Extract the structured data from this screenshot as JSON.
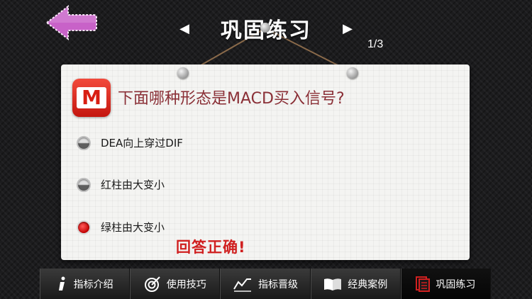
{
  "header": {
    "title": "巩固练习",
    "prev_arrow": "◀",
    "next_arrow": "▶",
    "counter": "1/3"
  },
  "question": {
    "logo_letter": "M",
    "text": "下面哪种形态是MACD买入信号?",
    "options": [
      {
        "label": "DEA向上穿过DIF",
        "selected": false
      },
      {
        "label": "红柱由大变小",
        "selected": false
      },
      {
        "label": "绿柱由大变小",
        "selected": true
      }
    ],
    "result": "回答正确!"
  },
  "tabs": [
    {
      "label": "指标介绍",
      "icon": "info-icon",
      "active": false
    },
    {
      "label": "使用技巧",
      "icon": "target-icon",
      "active": false
    },
    {
      "label": "指标晋级",
      "icon": "chart-up-icon",
      "active": false
    },
    {
      "label": "经典案例",
      "icon": "book-icon",
      "active": false
    },
    {
      "label": "巩固练习",
      "icon": "notes-icon",
      "active": true
    }
  ],
  "colors": {
    "accent_red": "#d02020",
    "question_text": "#8a2f36",
    "back_arrow": "#c25ac2"
  }
}
